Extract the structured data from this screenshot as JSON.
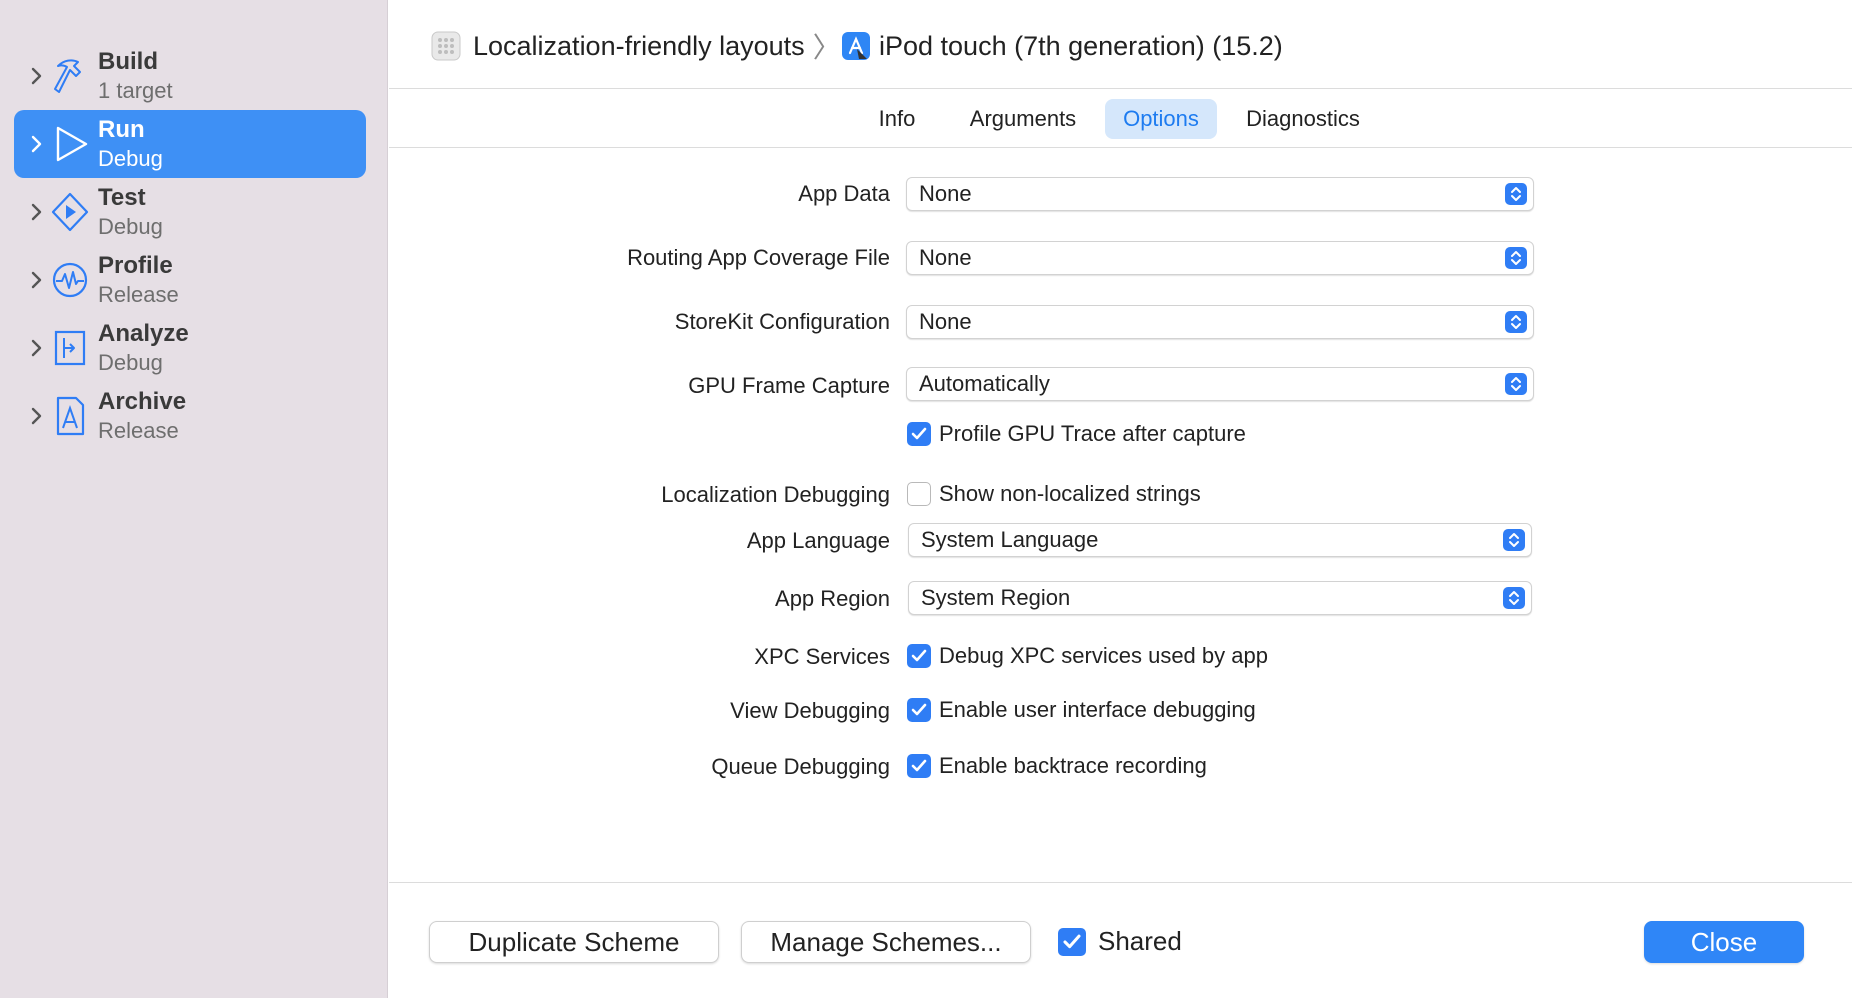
{
  "breadcrumb": {
    "project": "Localization-friendly layouts",
    "separator": "〉",
    "device": "iPod touch (7th generation) (15.2)"
  },
  "sidebar": {
    "items": [
      {
        "title": "Build",
        "subtitle": "1 target",
        "icon": "hammer-icon",
        "selected": false
      },
      {
        "title": "Run",
        "subtitle": "Debug",
        "icon": "play-icon",
        "selected": true
      },
      {
        "title": "Test",
        "subtitle": "Debug",
        "icon": "test-diamond-icon",
        "selected": false
      },
      {
        "title": "Profile",
        "subtitle": "Release",
        "icon": "waveform-icon",
        "selected": false
      },
      {
        "title": "Analyze",
        "subtitle": "Debug",
        "icon": "analyze-icon",
        "selected": false
      },
      {
        "title": "Archive",
        "subtitle": "Release",
        "icon": "archive-icon",
        "selected": false
      }
    ]
  },
  "tabs": [
    "Info",
    "Arguments",
    "Options",
    "Diagnostics"
  ],
  "active_tab": "Options",
  "form": {
    "app_data": {
      "label": "App Data",
      "value": "None"
    },
    "routing": {
      "label": "Routing App Coverage File",
      "value": "None"
    },
    "storekit": {
      "label": "StoreKit Configuration",
      "value": "None"
    },
    "gpu_capture": {
      "label": "GPU Frame Capture",
      "value": "Automatically"
    },
    "gpu_trace": {
      "label": "Profile GPU Trace after capture",
      "checked": true
    },
    "localization": {
      "label": "Localization Debugging",
      "option": "Show non-localized strings",
      "checked": false
    },
    "app_language": {
      "label": "App Language",
      "value": "System Language"
    },
    "app_region": {
      "label": "App Region",
      "value": "System Region"
    },
    "xpc": {
      "label": "XPC Services",
      "option": "Debug XPC services used by app",
      "checked": true
    },
    "view_debug": {
      "label": "View Debugging",
      "option": "Enable user interface debugging",
      "checked": true
    },
    "queue_debug": {
      "label": "Queue Debugging",
      "option": "Enable backtrace recording",
      "checked": true
    }
  },
  "footer": {
    "duplicate": "Duplicate Scheme",
    "manage": "Manage Schemes...",
    "shared_label": "Shared",
    "shared_checked": true,
    "close": "Close"
  },
  "colors": {
    "accent": "#2f7df5",
    "sidebar_bg": "#e6dfe5",
    "selected_row": "#3e90f5",
    "sidebar_icon": "#2f7df5"
  }
}
